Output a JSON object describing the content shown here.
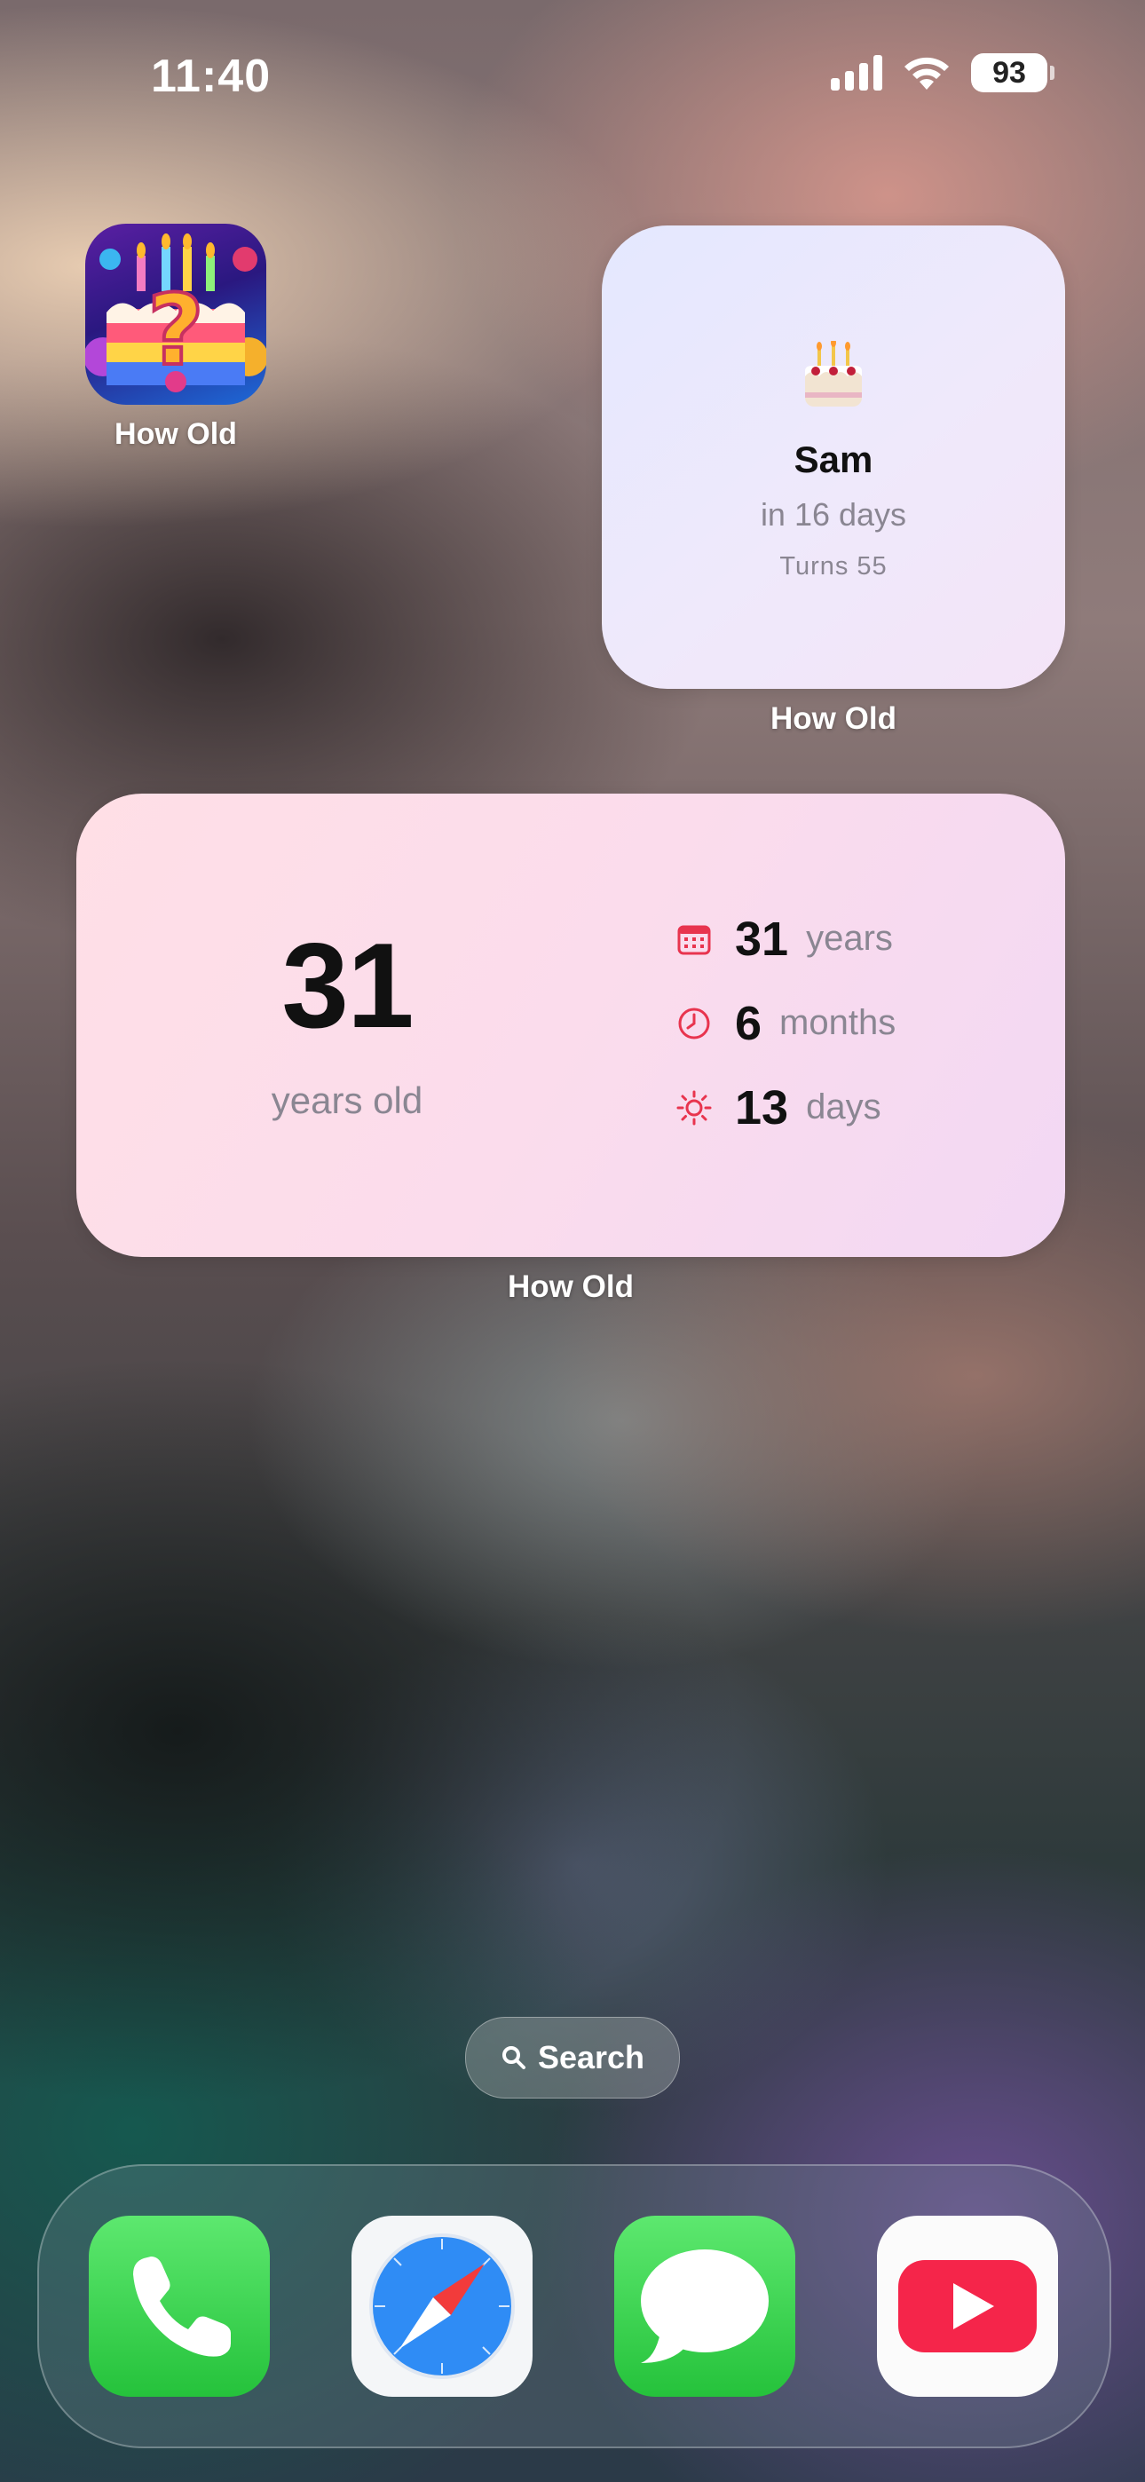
{
  "status_bar": {
    "time": "11:40",
    "battery": "93"
  },
  "app": {
    "name": "How Old",
    "icon": "birthday-cake-question-icon"
  },
  "widget_small": {
    "icon": "birthday-cake-emoji",
    "name": "Sam",
    "countdown": "in 16 days",
    "turns": "Turns 55",
    "label": "How Old"
  },
  "widget_medium": {
    "age": "31",
    "unit": "years old",
    "rows": [
      {
        "icon": "calendar-icon",
        "value": "31",
        "label": "years"
      },
      {
        "icon": "clock-icon",
        "value": "6",
        "label": "months"
      },
      {
        "icon": "sun-icon",
        "value": "13",
        "label": "days"
      }
    ],
    "label": "How Old"
  },
  "search": {
    "label": "Search"
  },
  "dock": [
    {
      "name": "phone-app",
      "icon": "phone-icon"
    },
    {
      "name": "safari-app",
      "icon": "compass-icon"
    },
    {
      "name": "messages-app",
      "icon": "speech-bubble-icon"
    },
    {
      "name": "youtube-app",
      "icon": "play-icon"
    }
  ],
  "colors": {
    "accent_red": "#e8344e",
    "muted_gray": "#8a8692"
  }
}
